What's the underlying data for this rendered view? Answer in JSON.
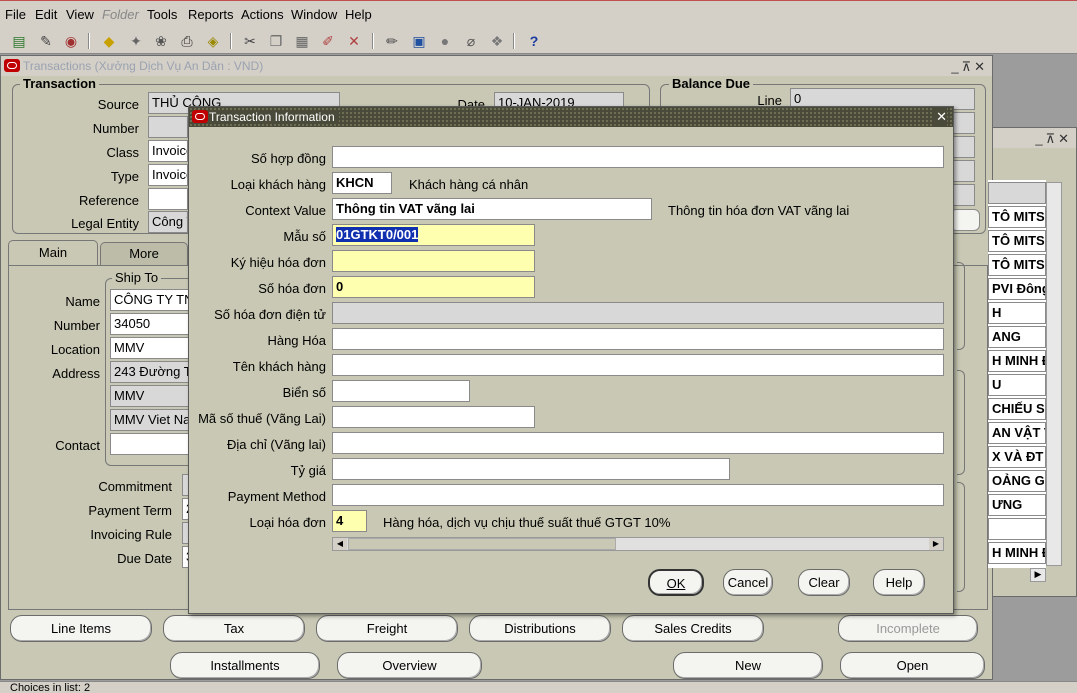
{
  "menu": {
    "file": "File",
    "edit": "Edit",
    "view": "View",
    "folder": "Folder",
    "tools": "Tools",
    "reports": "Reports",
    "actions": "Actions",
    "window": "Window",
    "help": "Help"
  },
  "toolbar_icons": [
    "new-icon",
    "find-icon",
    "navigator-icon",
    "save-icon",
    "next-step-icon",
    "switch-responsibility-icon",
    "print-icon",
    "close-form-icon",
    "cut-icon",
    "copy-icon",
    "paste-icon",
    "clear-record-icon",
    "delete-record-icon",
    "edit-field-icon",
    "zoom-icon",
    "translations-icon",
    "attachments-icon",
    "folder-tools-icon",
    "help-icon"
  ],
  "main_window": {
    "title": "Transactions (Xưởng Dịch Vụ An Dân : VND)",
    "transaction_group": "Transaction",
    "source_label": "Source",
    "source_value": "THỦ CÔNG",
    "number_label": "Number",
    "number_value": "",
    "class_label": "Class",
    "class_value": "Invoice",
    "type_label": "Type",
    "type_value": "Invoice",
    "reference_label": "Reference",
    "reference_value": "",
    "legal_entity_label": "Legal Entity",
    "legal_entity_value": "Công T",
    "date_label": "Date",
    "date_value": "10-JAN-2019",
    "balance_group": "Balance Due",
    "line_label": "Line",
    "line_value": "0",
    "tab_main": "Main",
    "tab_more": "More",
    "ship_to_group": "Ship To",
    "name_label": "Name",
    "name_value": "CÔNG TY TN",
    "ship_number_label": "Number",
    "ship_number_value": "34050",
    "location_label": "Location",
    "location_value": "MMV",
    "address_label": "Address",
    "address_line1": "243 Đường T",
    "address_line2": "MMV",
    "address_line3": "MMV Viet Na",
    "contact_label": "Contact",
    "contact_value": "",
    "commitment_label": "Commitment",
    "payment_term_label": "Payment Term",
    "payment_term_value": "2",
    "invoicing_rule_label": "Invoicing Rule",
    "due_date_label": "Due Date",
    "due_date_value": "3",
    "buttons": {
      "line_items": "Line Items",
      "tax": "Tax",
      "freight": "Freight",
      "distributions": "Distributions",
      "sales_credits": "Sales Credits",
      "incomplete": "Incomplete",
      "installments": "Installments",
      "overview": "Overview",
      "new": "New",
      "open": "Open"
    }
  },
  "side_list": [
    "TÔ MITS",
    "TÔ MITS",
    "TÔ MITS",
    "PVI Đông",
    "H",
    "ANG",
    "H MINH Đ",
    "U",
    "CHIẾU SÁ",
    "AN VẬT T",
    "X VÀ ĐT",
    "OẢNG G",
    "ƯNG",
    "",
    "H MINH Đ"
  ],
  "status_bar": "Choices in list: 2",
  "dialog": {
    "title": "Transaction Information",
    "fields": [
      {
        "label": "Số hợp đồng",
        "value": ""
      },
      {
        "label": "Loại khách hàng",
        "value": "KHCN",
        "desc": "Khách hàng cá nhân"
      },
      {
        "label": "Context Value",
        "value": "Thông tin VAT vãng lai",
        "desc": "Thông tin hóa đơn VAT vãng lai"
      },
      {
        "label": "Mẫu số",
        "value": "01GTKT0/001"
      },
      {
        "label": "Ký hiệu hóa đơn",
        "value": ""
      },
      {
        "label": "Số hóa đơn",
        "value": "0"
      },
      {
        "label": "Số hóa đơn điện tử",
        "value": ""
      },
      {
        "label": "Hàng Hóa",
        "value": ""
      },
      {
        "label": "Tên khách hàng",
        "value": ""
      },
      {
        "label": "Biển số",
        "value": ""
      },
      {
        "label": "Mã số thuế (Vãng Lai)",
        "value": ""
      },
      {
        "label": "Địa chỉ (Vãng lai)",
        "value": ""
      },
      {
        "label": "Tỷ giá",
        "value": ""
      },
      {
        "label": "Payment Method",
        "value": ""
      },
      {
        "label": "Loại hóa đơn",
        "value": "4",
        "desc": "Hàng hóa, dịch vụ chịu thuế suất thuế GTGT 10%"
      }
    ],
    "ok": "OK",
    "cancel": "Cancel",
    "clear": "Clear",
    "help": "Help"
  }
}
